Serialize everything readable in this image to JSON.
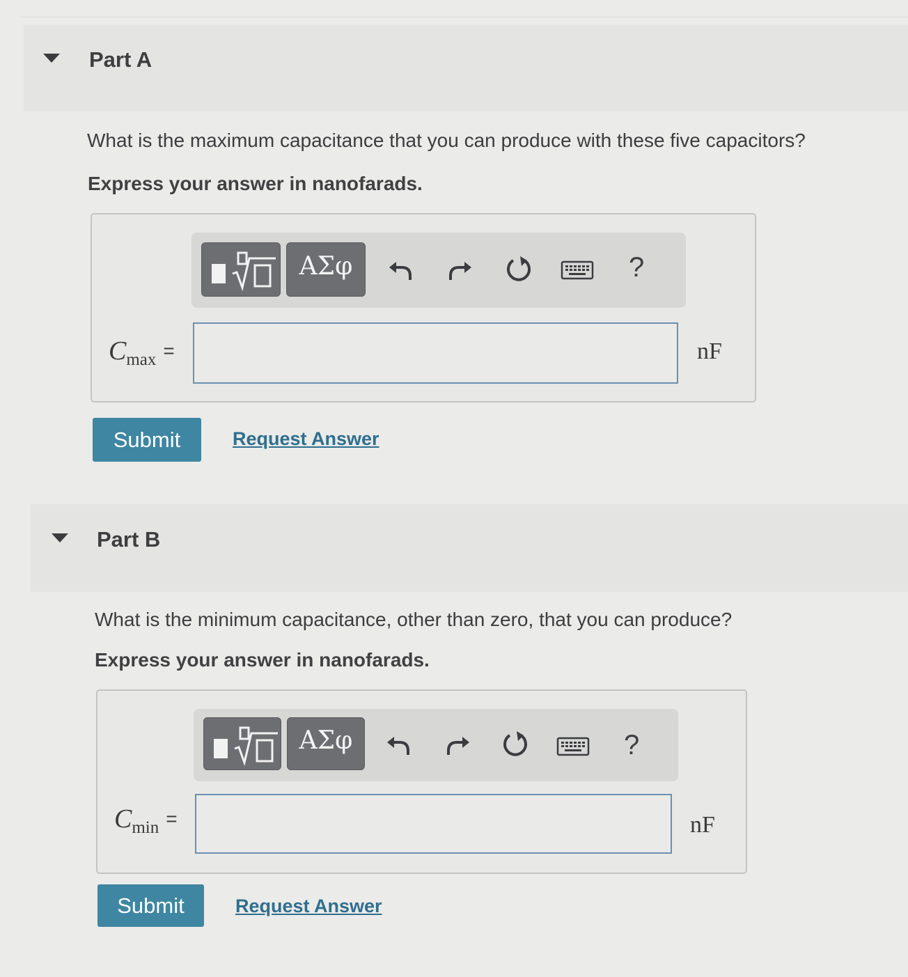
{
  "parts": [
    {
      "title": "Part A",
      "question": "What is the maximum capacitance that you can produce with these five capacitors?",
      "instruction": "Express your answer in nanofarads.",
      "toolbar": {
        "template_icon": "templates-sqrt-icon",
        "greek_label": "ΑΣφ",
        "undo_icon": "undo-icon",
        "redo_icon": "redo-icon",
        "reset_icon": "reset-icon",
        "keyboard_icon": "keyboard-icon",
        "help_label": "?"
      },
      "variable": {
        "symbol": "C",
        "subscript": "max",
        "equals": "="
      },
      "input_value": "",
      "unit": "nF",
      "submit_label": "Submit",
      "request_label": "Request Answer"
    },
    {
      "title": "Part B",
      "question": "What is the minimum capacitance, other than zero, that you can produce?",
      "instruction": "Express your answer in nanofarads.",
      "toolbar": {
        "template_icon": "templates-sqrt-icon",
        "greek_label": "ΑΣφ",
        "undo_icon": "undo-icon",
        "redo_icon": "redo-icon",
        "reset_icon": "reset-icon",
        "keyboard_icon": "keyboard-icon",
        "help_label": "?"
      },
      "variable": {
        "symbol": "C",
        "subscript": "min",
        "equals": "="
      },
      "input_value": "",
      "unit": "nF",
      "submit_label": "Submit",
      "request_label": "Request Answer"
    }
  ],
  "colors": {
    "accent": "#3e86a2",
    "link": "#2f6f8f",
    "toolbar_button": "#6d6e72",
    "input_border": "#6a8fb2"
  }
}
